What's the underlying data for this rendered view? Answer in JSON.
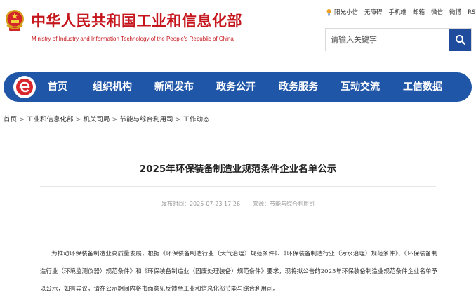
{
  "header": {
    "site_title": "中华人民共和国工业和信息化部",
    "site_subtitle": "Ministry of Industry and Information Technology of the People's Republic of China",
    "emblem_icon": "national-emblem-icon",
    "top_links": [
      "阳光小信",
      "无障碍",
      "手机端",
      "邮箱",
      "微信",
      "微博",
      "RSS订阅"
    ],
    "search_placeholder": "请输入关键字",
    "search_icon": "search-icon"
  },
  "nav": {
    "logo_icon": "site-logo-icon",
    "items": [
      "首页",
      "组织机构",
      "新闻发布",
      "政务公开",
      "政务服务",
      "互动交流",
      "工信数据"
    ]
  },
  "breadcrumb": [
    "首页",
    "工业和信息化部",
    "机关司局",
    "节能与综合利用司",
    "工作动态"
  ],
  "breadcrumb_separator": ">",
  "article": {
    "title": "2025年环保装备制造业规范条件企业名单公示",
    "published_label": "发布时间：",
    "published": "2025-07-23 17:26",
    "source_label": "来源：",
    "source": "节能与综合利用司",
    "body": "为推动环保装备制造业高质量发展，根据《环保装备制造行业（大气治理）规范条件》、《环保装备制造行业（污水治理）规范条件》、《环保装备制造行业（环境监测仪器）规范条件》和《环保装备制造业（固废处理装备）规范条件》要求，现将拟公告的2025年环保装备制造业规范条件企业名单予以公示，如有异议，请在公示期间内将书面意见反馈至工业和信息化部节能与综合利用司。"
  },
  "colors": {
    "brand_red": "#c4161c",
    "nav_blue": "#1f56a8",
    "search_blue": "#1f4c9c"
  }
}
